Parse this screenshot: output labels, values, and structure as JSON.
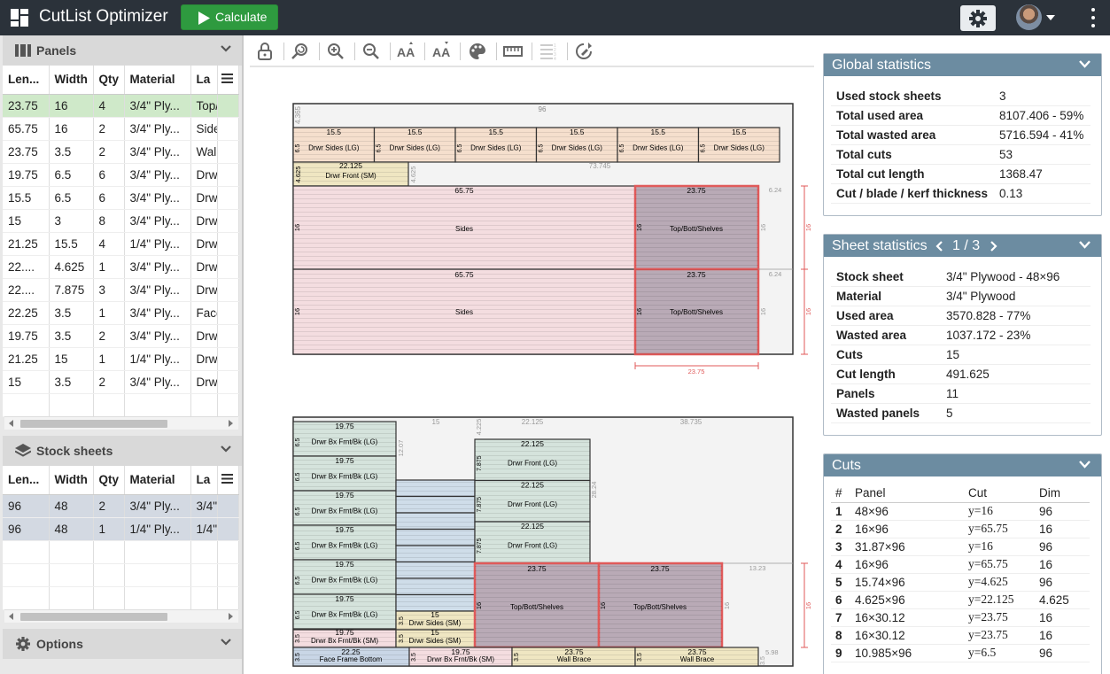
{
  "app": {
    "title": "CutList Optimizer",
    "calculate_label": "Calculate"
  },
  "panels": {
    "title": "Panels",
    "columns": [
      "Len...",
      "Width",
      "Qty",
      "Material",
      "La"
    ],
    "rows": [
      {
        "len": "23.75",
        "width": "16",
        "qty": "4",
        "material": "3/4\" Ply...",
        "label": "Top/Bot"
      },
      {
        "len": "65.75",
        "width": "16",
        "qty": "2",
        "material": "3/4\" Ply...",
        "label": "Sides"
      },
      {
        "len": "23.75",
        "width": "3.5",
        "qty": "2",
        "material": "3/4\" Ply...",
        "label": "Wall Br."
      },
      {
        "len": "19.75",
        "width": "6.5",
        "qty": "6",
        "material": "3/4\" Ply...",
        "label": "Drwr Bx"
      },
      {
        "len": "15.5",
        "width": "6.5",
        "qty": "6",
        "material": "3/4\" Ply...",
        "label": "Drwr Si."
      },
      {
        "len": "15",
        "width": "3",
        "qty": "8",
        "material": "3/4\" Ply...",
        "label": "Drwr Sli"
      },
      {
        "len": "21.25",
        "width": "15.5",
        "qty": "4",
        "material": "1/4\" Ply...",
        "label": "Drwr Bc"
      },
      {
        "len": "22....",
        "width": "4.625",
        "qty": "1",
        "material": "3/4\" Ply...",
        "label": "Drwr Fr"
      },
      {
        "len": "22....",
        "width": "7.875",
        "qty": "3",
        "material": "3/4\" Ply...",
        "label": "Drwr Fr"
      },
      {
        "len": "22.25",
        "width": "3.5",
        "qty": "1",
        "material": "3/4\" Ply...",
        "label": "Face Fr"
      },
      {
        "len": "19.75",
        "width": "3.5",
        "qty": "2",
        "material": "3/4\" Ply...",
        "label": "Drwr Bx"
      },
      {
        "len": "21.25",
        "width": "15",
        "qty": "1",
        "material": "1/4\" Ply...",
        "label": "Drwr Bc"
      },
      {
        "len": "15",
        "width": "3.5",
        "qty": "2",
        "material": "3/4\" Ply...",
        "label": "Drwr Si."
      }
    ]
  },
  "stock": {
    "title": "Stock sheets",
    "columns": [
      "Len...",
      "Width",
      "Qty",
      "Material",
      "La"
    ],
    "rows": [
      {
        "len": "96",
        "width": "48",
        "qty": "2",
        "material": "3/4\" Ply...",
        "label": "3/4\" Ply"
      },
      {
        "len": "96",
        "width": "48",
        "qty": "1",
        "material": "1/4\" Ply...",
        "label": "1/4\" Ply"
      }
    ]
  },
  "options": {
    "title": "Options"
  },
  "global_stats": {
    "title": "Global statistics",
    "rows": [
      {
        "k": "Used stock sheets",
        "v": "3"
      },
      {
        "k": "Total used area",
        "v": "8107.406 - 59%"
      },
      {
        "k": "Total wasted area",
        "v": "5716.594 - 41%"
      },
      {
        "k": "Total cuts",
        "v": "53"
      },
      {
        "k": "Total cut length",
        "v": "1368.47"
      },
      {
        "k": "Cut / blade / kerf thickness",
        "v": "0.13"
      }
    ]
  },
  "sheet_stats": {
    "title": "Sheet statistics",
    "page": "1 / 3",
    "rows": [
      {
        "k": "Stock sheet",
        "v": "3/4\" Plywood - 48×96"
      },
      {
        "k": "Material",
        "v": "3/4\" Plywood"
      },
      {
        "k": "Used area",
        "v": "3570.828 - 77%"
      },
      {
        "k": "Wasted area",
        "v": "1037.172 - 23%"
      },
      {
        "k": "Cuts",
        "v": "15"
      },
      {
        "k": "Cut length",
        "v": "491.625"
      },
      {
        "k": "Panels",
        "v": "11"
      },
      {
        "k": "Wasted panels",
        "v": "5"
      }
    ]
  },
  "cuts": {
    "title": "Cuts",
    "columns": [
      "#",
      "Panel",
      "Cut",
      "Dim"
    ],
    "rows": [
      {
        "n": "1",
        "panel": "48×96",
        "cut": "y=16",
        "dim": "96"
      },
      {
        "n": "2",
        "panel": "16×96",
        "cut": "y=65.75",
        "dim": "16"
      },
      {
        "n": "3",
        "panel": "31.87×96",
        "cut": "y=16",
        "dim": "96"
      },
      {
        "n": "4",
        "panel": "16×96",
        "cut": "y=65.75",
        "dim": "16"
      },
      {
        "n": "5",
        "panel": "15.74×96",
        "cut": "y=4.625",
        "dim": "96"
      },
      {
        "n": "6",
        "panel": "4.625×96",
        "cut": "y=22.125",
        "dim": "4.625"
      },
      {
        "n": "7",
        "panel": "16×30.12",
        "cut": "y=23.75",
        "dim": "16"
      },
      {
        "n": "8",
        "panel": "16×30.12",
        "cut": "y=23.75",
        "dim": "16"
      },
      {
        "n": "9",
        "panel": "10.985×96",
        "cut": "y=6.5",
        "dim": "96"
      }
    ]
  },
  "sheet1": {
    "top_dim": "96",
    "left_dim": "4.365",
    "drawer_len": "15.5",
    "drawer_w": "6.5",
    "drawer_label": "Drwr Sides (LG)",
    "front_len": "22.125",
    "front_w": "4.625",
    "front_label": "Drwr Front (SM)",
    "waste_len": "73.745",
    "sides_len": "65.75",
    "sides_w": "16",
    "sides_label": "Sides",
    "top_len": "23.75",
    "top_label": "Top/Bott/Shelves",
    "offcut_w": "6.24",
    "dim_16": "16",
    "dim_2375": "23.75"
  },
  "sheet2": {
    "bx_len": "19.75",
    "bx_w": "6.5",
    "bx_label": "Drwr Bx Frnt/Bk (LG)",
    "bx_sm_label": "Drwr Bx Frnt/Bk (SM)",
    "bx_sm_w": "3.5",
    "col_waste": "12.07",
    "slide_col": "15",
    "side_sm_len": "15",
    "side_sm_label": "Drwr Sides (SM)",
    "waste_4225": "4.225",
    "front_lg_len": "22.125",
    "front_lg_w": "7.875",
    "front_lg_label": "Drwr Front (LG)",
    "waste_2824": "28.24",
    "waste_38735": "38.735",
    "top_len": "23.75",
    "top_w": "16",
    "top_label": "Top/Bott/Shelves",
    "waste_1323": "13.23",
    "face_len": "22.25",
    "face_w": "3.5",
    "face_label": "Face Frame Bottom",
    "bx2_len": "19.75",
    "wall_len": "23.75",
    "wall_label": "Wall Brace",
    "waste_598": "5.98",
    "dim_16": "16"
  }
}
